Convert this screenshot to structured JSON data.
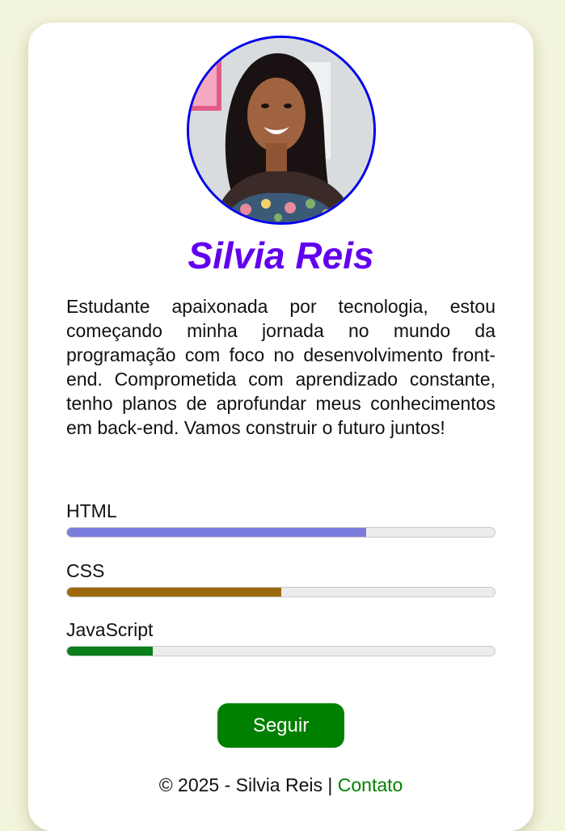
{
  "profile": {
    "name": "Silvia Reis",
    "bio": "Estudante apaixonada por tecnologia, estou começando minha jornada no mundo da programação com foco no desenvolvimento front-end. Comprometida com aprendizado constante, tenho planos de aprofundar meus conhecimentos em back-end. Vamos construir o futuro juntos!",
    "avatar": "profile-photo"
  },
  "skills": [
    {
      "label": "HTML",
      "level_percent": 70,
      "color": "#7b7bdc"
    },
    {
      "label": "CSS",
      "level_percent": 50,
      "color": "#9c6a0d"
    },
    {
      "label": "JavaScript",
      "level_percent": 20,
      "color": "#0a7f1a"
    }
  ],
  "follow_button": {
    "label": "Seguir",
    "color": "#008000"
  },
  "footer": {
    "text": "© 2025 - Silvia Reis | ",
    "contact_link": "Contato"
  },
  "colors": {
    "background": "#f3f4dc",
    "name": "#6200ee",
    "avatar_border": "#0000ee"
  }
}
